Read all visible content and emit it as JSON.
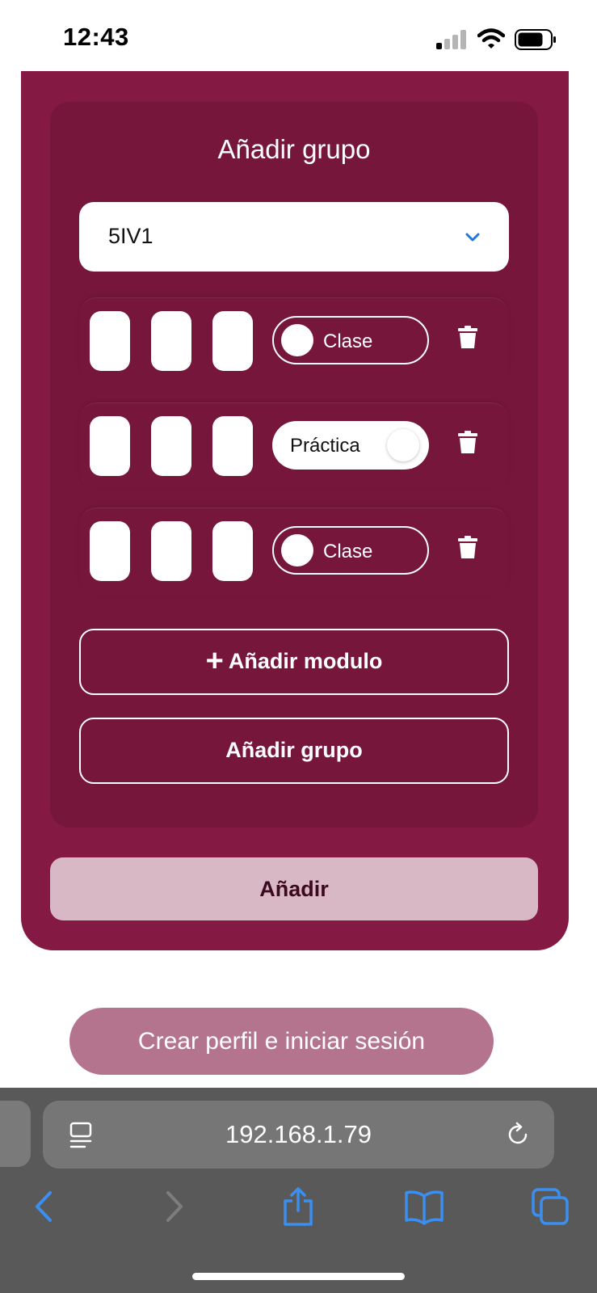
{
  "status_bar": {
    "time": "12:43",
    "icons": [
      "cellular-signal-icon",
      "wifi-icon",
      "battery-icon"
    ]
  },
  "form": {
    "group_section": {
      "title": "Añadir grupo",
      "group_select": {
        "selected": "5IV1",
        "icon": "chevron-down-icon"
      },
      "modules": [
        {
          "type_toggle": {
            "label": "Clase",
            "on": false
          },
          "delete_icon": "trash-icon"
        },
        {
          "type_toggle": {
            "label": "Práctica",
            "on": true
          },
          "delete_icon": "trash-icon"
        },
        {
          "type_toggle": {
            "label": "Clase",
            "on": false
          },
          "delete_icon": "trash-icon"
        }
      ],
      "add_module_label": "Añadir modulo",
      "add_module_icon": "plus-icon",
      "add_group_label": "Añadir grupo"
    },
    "submit_label": "Añadir"
  },
  "create_profile_label": "Crear perfil e iniciar sesión",
  "browser": {
    "url": "192.168.1.79",
    "toolbar_icons": [
      "back-icon",
      "forward-icon",
      "share-icon",
      "bookmarks-icon",
      "tabs-icon"
    ]
  },
  "colors": {
    "card": "#841a43",
    "inner_panel": "#75163a",
    "submit_button": "#d9b8c5",
    "profile_button": "#b5748e",
    "select_chevron": "#1f7ae0",
    "browser_chrome": "#595959",
    "browser_accent": "#3b8ff0"
  }
}
